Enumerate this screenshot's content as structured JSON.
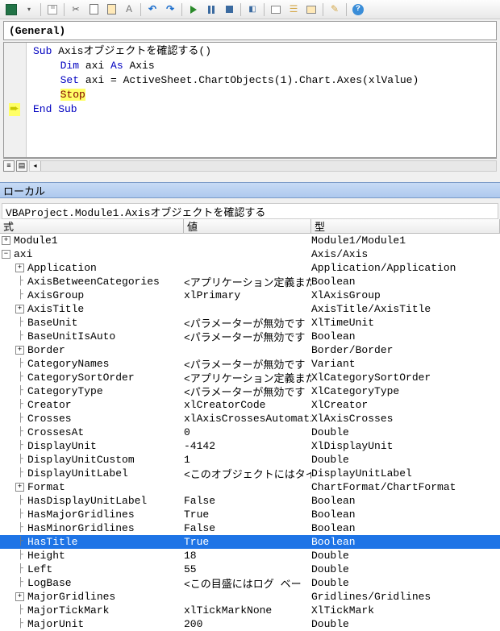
{
  "dropdown": {
    "label": "(General)"
  },
  "code": {
    "l1_sub": "Sub",
    "l1_name": " Axisオブジェクトを確認する()",
    "l2_dim": "Dim",
    "l2_mid": " axi ",
    "l2_as": "As",
    "l2_tail": " Axis",
    "l3_set": "Set",
    "l3_tail": " axi = ActiveSheet.ChartObjects(1).Chart.Axes(xlValue)",
    "l4_stop": "Stop",
    "l5_end": "End Sub"
  },
  "locals_title": "ローカル",
  "context_path": "VBAProject.Module1.Axisオブジェクトを確認する",
  "headers": {
    "expr": "式",
    "val": "値",
    "typ": "型"
  },
  "rows": [
    {
      "icon": "plus",
      "depth": 0,
      "expr": "Module1",
      "val": "",
      "typ": "Module1/Module1"
    },
    {
      "icon": "minus",
      "depth": 0,
      "expr": "axi",
      "val": "",
      "typ": "Axis/Axis"
    },
    {
      "icon": "plus",
      "depth": 1,
      "expr": "Application",
      "val": "",
      "typ": "Application/Application"
    },
    {
      "icon": "leaf",
      "depth": 1,
      "expr": "AxisBetweenCategories",
      "val": "<アプリケーション定義また",
      "typ": "Boolean"
    },
    {
      "icon": "leaf",
      "depth": 1,
      "expr": "AxisGroup",
      "val": "xlPrimary",
      "typ": "XlAxisGroup"
    },
    {
      "icon": "plus",
      "depth": 1,
      "expr": "AxisTitle",
      "val": "",
      "typ": "AxisTitle/AxisTitle"
    },
    {
      "icon": "leaf",
      "depth": 1,
      "expr": "BaseUnit",
      "val": "<パラメーターが無効です",
      "typ": "XlTimeUnit"
    },
    {
      "icon": "leaf",
      "depth": 1,
      "expr": "BaseUnitIsAuto",
      "val": "<パラメーターが無効です",
      "typ": "Boolean"
    },
    {
      "icon": "plus",
      "depth": 1,
      "expr": "Border",
      "val": "",
      "typ": "Border/Border"
    },
    {
      "icon": "leaf",
      "depth": 1,
      "expr": "CategoryNames",
      "val": "<パラメーターが無効です",
      "typ": "Variant"
    },
    {
      "icon": "leaf",
      "depth": 1,
      "expr": "CategorySortOrder",
      "val": "<アプリケーション定義また",
      "typ": "XlCategorySortOrder"
    },
    {
      "icon": "leaf",
      "depth": 1,
      "expr": "CategoryType",
      "val": "<パラメーターが無効です",
      "typ": "XlCategoryType"
    },
    {
      "icon": "leaf",
      "depth": 1,
      "expr": "Creator",
      "val": "xlCreatorCode",
      "typ": "XlCreator"
    },
    {
      "icon": "leaf",
      "depth": 1,
      "expr": "Crosses",
      "val": "xlAxisCrossesAutomatic",
      "typ": "XlAxisCrosses"
    },
    {
      "icon": "leaf",
      "depth": 1,
      "expr": "CrossesAt",
      "val": "0",
      "typ": "Double"
    },
    {
      "icon": "leaf",
      "depth": 1,
      "expr": "DisplayUnit",
      "val": "-4142",
      "typ": "XlDisplayUnit"
    },
    {
      "icon": "leaf",
      "depth": 1,
      "expr": "DisplayUnitCustom",
      "val": "1",
      "typ": "Double"
    },
    {
      "icon": "leaf",
      "depth": 1,
      "expr": "DisplayUnitLabel",
      "val": "<このオブジェクトにはタイ",
      "typ": "DisplayUnitLabel"
    },
    {
      "icon": "plus",
      "depth": 1,
      "expr": "Format",
      "val": "",
      "typ": "ChartFormat/ChartFormat"
    },
    {
      "icon": "leaf",
      "depth": 1,
      "expr": "HasDisplayUnitLabel",
      "val": "False",
      "typ": "Boolean"
    },
    {
      "icon": "leaf",
      "depth": 1,
      "expr": "HasMajorGridlines",
      "val": "True",
      "typ": "Boolean"
    },
    {
      "icon": "leaf",
      "depth": 1,
      "expr": "HasMinorGridlines",
      "val": "False",
      "typ": "Boolean"
    },
    {
      "icon": "leaf",
      "depth": 1,
      "expr": "HasTitle",
      "val": "True",
      "typ": "Boolean",
      "selected": true
    },
    {
      "icon": "leaf",
      "depth": 1,
      "expr": "Height",
      "val": "18",
      "typ": "Double"
    },
    {
      "icon": "leaf",
      "depth": 1,
      "expr": "Left",
      "val": "55",
      "typ": "Double"
    },
    {
      "icon": "leaf",
      "depth": 1,
      "expr": "LogBase",
      "val": "<この目盛にはログ ベー",
      "typ": "Double"
    },
    {
      "icon": "plus",
      "depth": 1,
      "expr": "MajorGridlines",
      "val": "",
      "typ": "Gridlines/Gridlines"
    },
    {
      "icon": "leaf",
      "depth": 1,
      "expr": "MajorTickMark",
      "val": "xlTickMarkNone",
      "typ": "XlTickMark"
    },
    {
      "icon": "leaf",
      "depth": 1,
      "expr": "MajorUnit",
      "val": "200",
      "typ": "Double"
    }
  ]
}
